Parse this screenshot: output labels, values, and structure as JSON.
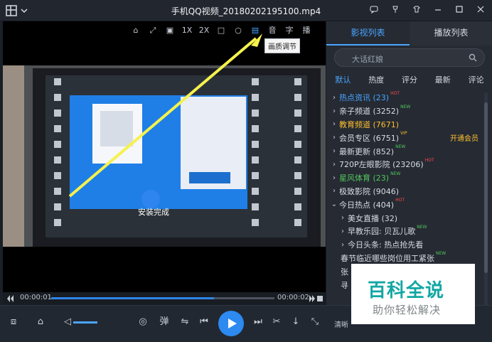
{
  "window": {
    "title": "手机QQ视频_20180202195100.mp4",
    "icons": [
      "app-grid-icon",
      "chevron-down-icon",
      "chat-icon",
      "pin-icon",
      "shirt-icon",
      "minimize-icon",
      "maximize-icon",
      "close-icon"
    ]
  },
  "video_toolbar": {
    "tools": [
      "",
      "",
      "",
      "1X",
      "2X",
      "",
      "",
      "",
      "音",
      "字",
      "播"
    ],
    "tooltip": "画质调节"
  },
  "playback": {
    "elapsed": "00:00:01",
    "duration": "00:00:02",
    "progress": 0.73
  },
  "sidebar": {
    "tabs": [
      "影视列表",
      "播放列表"
    ],
    "search_placeholder": "大话红娘",
    "sorts": [
      "默认",
      "热度",
      "评分",
      "最新",
      "评论"
    ],
    "items": [
      {
        "label": "热点资讯 (23)",
        "badge": "HOT",
        "color": "#4aa5ff"
      },
      {
        "label": "亲子频道 (3252)",
        "badge": "NEW",
        "color": "#d8dce4"
      },
      {
        "label": "教育频道 (7671)",
        "badge": "",
        "color": "#ffbf2f"
      },
      {
        "label": "会员专区 (6751)",
        "badge": "VIP",
        "color": "#d8dce4"
      },
      {
        "label": "最新更新 (852)",
        "badge": "NEW",
        "color": "#d8dce4"
      },
      {
        "label": "720P左眼影院 (23206)",
        "badge": "HOT",
        "color": "#d8dce4"
      },
      {
        "label": "星风体育 (23)",
        "badge": "NEW",
        "color": "#53c85b"
      },
      {
        "label": "极致影院 (9046)",
        "badge": "",
        "color": "#d8dce4"
      },
      {
        "label": "今日热点 (404)",
        "badge": "HOT",
        "color": "#d8dce4"
      },
      {
        "label": "美女直播 (32)",
        "badge": "",
        "color": "#d8dce4"
      },
      {
        "label": "早教乐园: 贝瓦儿歌",
        "badge": "NEW",
        "color": "#d8dce4"
      },
      {
        "label": "今日头条: 热点抢先看",
        "badge": "",
        "color": "#d8dce4"
      },
      {
        "label": "春节临近哪些岗位用工紧张",
        "badge": "NEW",
        "color": "#d8dce4"
      },
      {
        "label": "张",
        "badge": "",
        "color": "#d8dce4"
      },
      {
        "label": "寻",
        "badge": "",
        "color": "#d8dce4"
      }
    ],
    "vip_link": "开通会员"
  },
  "controls": {
    "danmaku": "弹",
    "clear": "清晰"
  },
  "watermark": {
    "title": "百科全说",
    "subtitle": "助你轻松解决"
  }
}
